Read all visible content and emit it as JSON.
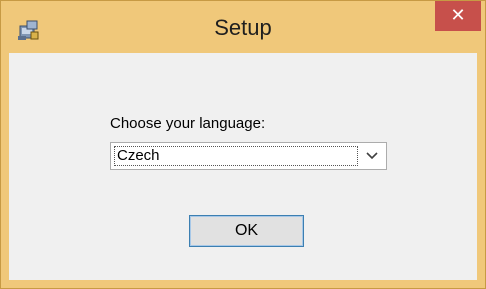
{
  "window": {
    "title": "Setup",
    "app_icon": "setup-installer-icon",
    "close_icon": "close-icon",
    "close_glyph": "✕"
  },
  "dialog": {
    "prompt": "Choose your language:",
    "language_select": {
      "selected": "Czech",
      "arrow_icon": "chevron-down-icon"
    },
    "ok_label": "OK"
  },
  "colors": {
    "title_frame": "#f0c87a",
    "close_button": "#c7504b",
    "client_background": "#f0f0f0",
    "button_focus_border": "#3c7fb1"
  }
}
